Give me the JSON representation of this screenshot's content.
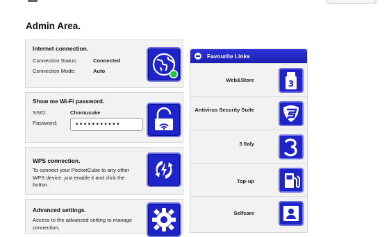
{
  "page": {
    "title": "Admin Area."
  },
  "internet": {
    "title": "Internet connection.",
    "status_label": "Connection Status:",
    "status_value": "Connected",
    "mode_label": "Connection Mode:",
    "mode_value": "Auto",
    "icon": "globe-icon",
    "status_indicator_color": "#22c43a"
  },
  "wifi": {
    "title": "Show me Wi-Fi password.",
    "ssid_label": "SSID:",
    "ssid_value": "Chomusuke",
    "password_label": "Password:",
    "password_value": "•••••••••••",
    "icon": "unlocked-padlock-wifi-icon"
  },
  "wps": {
    "title": "WPS connection.",
    "description": "To connect your PocketCube to any other WPS device, just enable it and click the button.",
    "icon": "wps-icon"
  },
  "advanced": {
    "title": "Advanced settings.",
    "description": "Access to the advanced setting to manage connection,",
    "icon": "gear-icon"
  },
  "favourites": {
    "title": "Favourite Links",
    "items": [
      {
        "label": "Web&Store",
        "icon": "three-usb-stick-icon"
      },
      {
        "label": "Antivirus Security Suite",
        "icon": "shield-f-icon"
      },
      {
        "label": "3 Italy",
        "icon": "three-logo-icon"
      },
      {
        "label": "Top-up",
        "icon": "fuel-pump-icon"
      },
      {
        "label": "Selfcare",
        "icon": "profile-card-icon"
      }
    ]
  },
  "colors": {
    "tile_blue": "#1f24c8",
    "tile_border": "#6f72e6",
    "header_blue": "#2d32d8",
    "card_bg": "#f2f2f2"
  }
}
